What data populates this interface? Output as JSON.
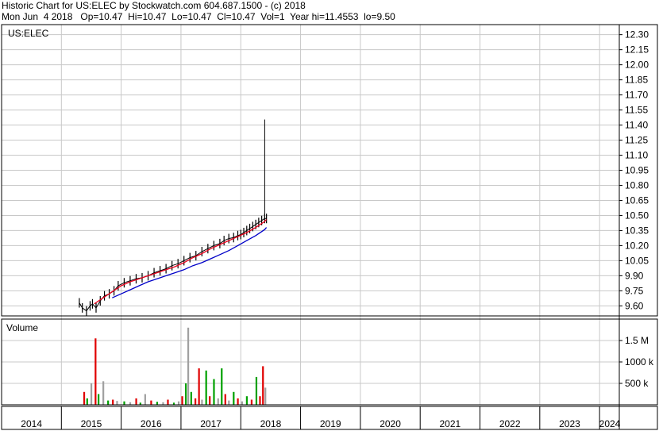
{
  "header": {
    "line1": "Historic Chart for US:ELEC by Stockwatch.com 604.687.1500 - (c) 2018",
    "line2": "Mon Jun  4 2018   Op=10.47  Hi=10.47  Lo=10.47  Cl=10.47  Vol=1  Year hi=11.4553  lo=9.50"
  },
  "chart_data": [
    {
      "type": "line",
      "title": "US:ELEC",
      "yaxis": {
        "ticks": [
          "12.30",
          "12.15",
          "12.00",
          "11.85",
          "11.70",
          "11.55",
          "11.40",
          "11.25",
          "11.10",
          "10.95",
          "10.80",
          "10.65",
          "10.50",
          "10.35",
          "10.20",
          "10.05",
          "9.90",
          "9.75",
          "9.60"
        ],
        "range": [
          9.5,
          12.4
        ]
      },
      "grid": true,
      "series": [
        {
          "role": "price-close",
          "color": "#000000",
          "x": [
            2015.3,
            2015.35,
            2015.42,
            2015.48,
            2015.52,
            2015.58,
            2015.65,
            2015.72,
            2015.8,
            2015.88,
            2015.95,
            2016.05,
            2016.15,
            2016.25,
            2016.35,
            2016.45,
            2016.55,
            2016.65,
            2016.75,
            2016.85,
            2016.95,
            2017.05,
            2017.15,
            2017.25,
            2017.35,
            2017.45,
            2017.55,
            2017.65,
            2017.72,
            2017.8,
            2017.88,
            2017.95,
            2018.0,
            2018.05,
            2018.1,
            2018.15,
            2018.2,
            2018.25,
            2018.3,
            2018.35,
            2018.4,
            2018.43
          ],
          "y": [
            9.63,
            9.58,
            9.55,
            9.6,
            9.62,
            9.58,
            9.65,
            9.7,
            9.72,
            9.75,
            9.8,
            9.83,
            9.85,
            9.87,
            9.88,
            9.9,
            9.93,
            9.95,
            9.97,
            10.0,
            10.02,
            10.05,
            10.08,
            10.1,
            10.14,
            10.17,
            10.2,
            10.22,
            10.25,
            10.27,
            10.28,
            10.3,
            10.31,
            10.33,
            10.35,
            10.37,
            10.39,
            10.41,
            10.43,
            10.45,
            10.47,
            10.47
          ]
        },
        {
          "role": "moving-average-short",
          "color": "#e8001c",
          "x": [
            2015.55,
            2015.7,
            2015.85,
            2016.0,
            2016.15,
            2016.3,
            2016.45,
            2016.6,
            2016.75,
            2016.9,
            2017.05,
            2017.2,
            2017.35,
            2017.5,
            2017.65,
            2017.8,
            2017.95,
            2018.1,
            2018.25,
            2018.4,
            2018.43
          ],
          "y": [
            9.62,
            9.68,
            9.74,
            9.8,
            9.84,
            9.87,
            9.9,
            9.93,
            9.96,
            9.99,
            10.03,
            10.08,
            10.12,
            10.17,
            10.21,
            10.25,
            10.29,
            10.33,
            10.38,
            10.44,
            10.46
          ]
        },
        {
          "role": "moving-average-long",
          "color": "#0000c8",
          "x": [
            2015.85,
            2016.0,
            2016.15,
            2016.3,
            2016.45,
            2016.6,
            2016.75,
            2016.9,
            2017.05,
            2017.2,
            2017.35,
            2017.5,
            2017.65,
            2017.8,
            2017.95,
            2018.1,
            2018.25,
            2018.4,
            2018.43
          ],
          "y": [
            9.68,
            9.72,
            9.76,
            9.8,
            9.84,
            9.87,
            9.9,
            9.93,
            9.96,
            10.0,
            10.03,
            10.07,
            10.11,
            10.15,
            10.2,
            10.25,
            10.3,
            10.36,
            10.38
          ]
        }
      ],
      "spike": {
        "x": 2018.4,
        "high": 11.4553,
        "low": 10.47
      }
    },
    {
      "type": "bar",
      "title": "Volume",
      "yaxis": {
        "ticks": [
          "1.5 M",
          "1000 k",
          "500 k"
        ],
        "range": [
          0,
          2000000
        ]
      },
      "grid": true,
      "colors": {
        "up": "#00a000",
        "down": "#e00000",
        "neutral": "#a0a0a0"
      },
      "bars": [
        {
          "x": 2015.38,
          "v": 300000,
          "c": "down"
        },
        {
          "x": 2015.43,
          "v": 150000,
          "c": "up"
        },
        {
          "x": 2015.5,
          "v": 500000,
          "c": "neutral"
        },
        {
          "x": 2015.57,
          "v": 1550000,
          "c": "down"
        },
        {
          "x": 2015.62,
          "v": 250000,
          "c": "up"
        },
        {
          "x": 2015.7,
          "v": 550000,
          "c": "neutral"
        },
        {
          "x": 2015.78,
          "v": 100000,
          "c": "up"
        },
        {
          "x": 2015.86,
          "v": 120000,
          "c": "down"
        },
        {
          "x": 2015.93,
          "v": 90000,
          "c": "neutral"
        },
        {
          "x": 2016.05,
          "v": 80000,
          "c": "up"
        },
        {
          "x": 2016.15,
          "v": 60000,
          "c": "neutral"
        },
        {
          "x": 2016.25,
          "v": 150000,
          "c": "down"
        },
        {
          "x": 2016.32,
          "v": 50000,
          "c": "up"
        },
        {
          "x": 2016.4,
          "v": 250000,
          "c": "neutral"
        },
        {
          "x": 2016.5,
          "v": 100000,
          "c": "down"
        },
        {
          "x": 2016.6,
          "v": 70000,
          "c": "up"
        },
        {
          "x": 2016.7,
          "v": 60000,
          "c": "neutral"
        },
        {
          "x": 2016.78,
          "v": 120000,
          "c": "down"
        },
        {
          "x": 2016.88,
          "v": 50000,
          "c": "up"
        },
        {
          "x": 2016.96,
          "v": 80000,
          "c": "neutral"
        },
        {
          "x": 2017.02,
          "v": 200000,
          "c": "down"
        },
        {
          "x": 2017.08,
          "v": 500000,
          "c": "up"
        },
        {
          "x": 2017.12,
          "v": 1800000,
          "c": "neutral"
        },
        {
          "x": 2017.17,
          "v": 300000,
          "c": "up"
        },
        {
          "x": 2017.24,
          "v": 150000,
          "c": "down"
        },
        {
          "x": 2017.3,
          "v": 850000,
          "c": "down"
        },
        {
          "x": 2017.35,
          "v": 120000,
          "c": "neutral"
        },
        {
          "x": 2017.42,
          "v": 800000,
          "c": "up"
        },
        {
          "x": 2017.48,
          "v": 200000,
          "c": "down"
        },
        {
          "x": 2017.55,
          "v": 600000,
          "c": "up"
        },
        {
          "x": 2017.62,
          "v": 150000,
          "c": "neutral"
        },
        {
          "x": 2017.68,
          "v": 850000,
          "c": "up"
        },
        {
          "x": 2017.74,
          "v": 250000,
          "c": "down"
        },
        {
          "x": 2017.8,
          "v": 100000,
          "c": "neutral"
        },
        {
          "x": 2017.88,
          "v": 300000,
          "c": "up"
        },
        {
          "x": 2017.95,
          "v": 150000,
          "c": "down"
        },
        {
          "x": 2018.02,
          "v": 80000,
          "c": "neutral"
        },
        {
          "x": 2018.1,
          "v": 200000,
          "c": "up"
        },
        {
          "x": 2018.18,
          "v": 120000,
          "c": "down"
        },
        {
          "x": 2018.26,
          "v": 650000,
          "c": "up"
        },
        {
          "x": 2018.32,
          "v": 200000,
          "c": "down"
        },
        {
          "x": 2018.37,
          "v": 900000,
          "c": "down"
        },
        {
          "x": 2018.41,
          "v": 400000,
          "c": "neutral"
        }
      ]
    }
  ],
  "xaxis": {
    "labels": [
      "2014",
      "2015",
      "2016",
      "2017",
      "2018",
      "2019",
      "2020",
      "2021",
      "2022",
      "2023",
      "2024"
    ]
  }
}
